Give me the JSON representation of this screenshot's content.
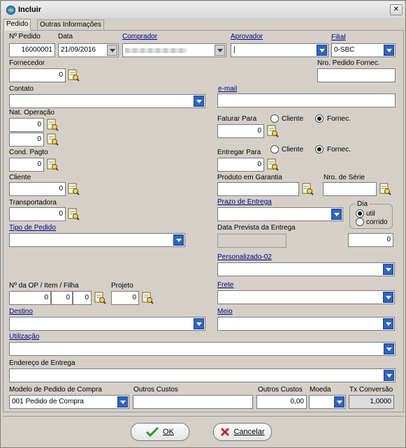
{
  "window": {
    "title": "Incluir",
    "close_glyph": "✕"
  },
  "tabs": [
    "Pedido",
    "Outras Informações"
  ],
  "labels": {
    "nr_pedido": "Nº Pedido",
    "data": "Data",
    "comprador": "Comprador",
    "aprovador": "Aprovador",
    "filial": "Filial",
    "fornecedor": "Fornecedor",
    "nro_pedido_fornec": "Nro. Pedido Fornec.",
    "contato": "Contato",
    "email": "e-mail",
    "nat_operacao": "Nat. Operação",
    "faturar_para": "Faturar Para",
    "cliente_opt": "Cliente",
    "fornec_opt": "Fornec.",
    "cond_pagto": "Cond. Pagto",
    "entregar_para": "Entregar Para",
    "cliente": "Cliente",
    "produto_garantia": "Produto em Garantia",
    "nro_serie": "Nro. de Série",
    "transportadora": "Transportadora",
    "prazo_entrega": "Prazo de Entrega",
    "dia": "Dia",
    "util": "util",
    "corrido": "corrido",
    "tipo_pedido": "Tipo de Pedido",
    "data_prevista": "Data Prevista da Entrega",
    "personalizado": "Personalizado-02",
    "nr_op": "Nº da OP / Item / Filha",
    "projeto": "Projeto",
    "frete": "Frete",
    "destino": "Destino",
    "meio": "Meio",
    "utilizacao": "Utilização",
    "endereco": "Endereço de Entrega",
    "modelo": "Modelo de Pedido de Compra",
    "outros_custos": "Outros Custos",
    "outros_custos_val": "Outros Custos",
    "moeda": "Moeda",
    "tx_conversao": "Tx Conversão"
  },
  "values": {
    "nr_pedido": "16000001",
    "data": "21/09/2016",
    "comprador": "",
    "aprovador": "|",
    "filial": "0-SBC",
    "fornecedor": "0",
    "nro_pedido_fornec": "",
    "contato": "",
    "email": "",
    "nat_op_1": "0",
    "nat_op_2": "0",
    "faturar_para": "0",
    "faturar_selected": "Fornec.",
    "cond_pagto": "0",
    "entregar_para": "0",
    "entregar_selected": "Fornec.",
    "cliente": "0",
    "produto_garantia": "",
    "nro_serie": "",
    "transportadora": "0",
    "prazo_entrega": "",
    "dia_selected": "util",
    "tipo_pedido": "",
    "data_prevista": "",
    "dias_prazo": "0",
    "personalizado": "",
    "op": "0",
    "item": "0",
    "filha": "0",
    "projeto": "0",
    "frete": "",
    "destino": "",
    "meio": "",
    "utilizacao": "",
    "endereco": "",
    "modelo": "001  Pedido de Compra",
    "outros_custos_desc": "",
    "outros_custos_val": "0,00",
    "moeda": "",
    "tx_conversao": "1,0000"
  },
  "buttons": {
    "ok": "OK",
    "cancelar": "Cancelar"
  },
  "colors": {
    "window_bg": "#d4d0c8",
    "accent_dropdown": "#2d66c2",
    "ok_check": "#2a9d2a",
    "cancel_x": "#c62828"
  }
}
